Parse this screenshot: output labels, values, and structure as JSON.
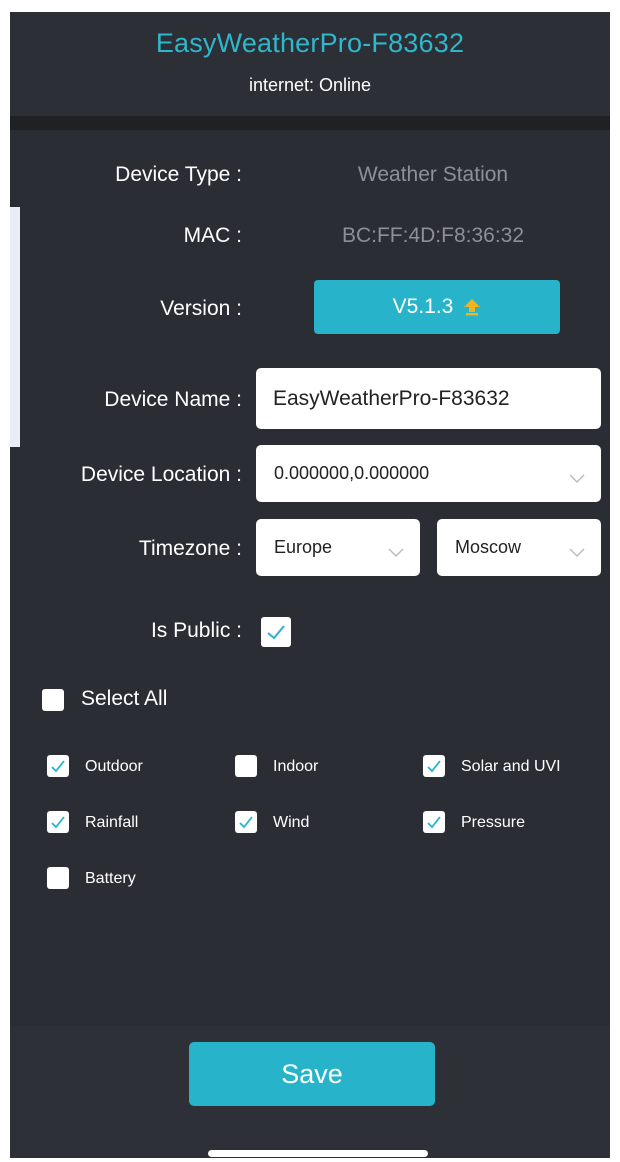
{
  "header": {
    "title": "EasyWeatherPro-F83632",
    "status": "internet: Online"
  },
  "device": {
    "type_label": "Device Type :",
    "type_value": "Weather Station",
    "mac_label": "MAC :",
    "mac_value": "BC:FF:4D:F8:36:32",
    "version_label": "Version :",
    "version_value": "V5.1.3",
    "name_label": "Device Name :",
    "name_value": "EasyWeatherPro-F83632",
    "location_label": "Device Location :",
    "location_value": "0.000000,0.000000",
    "timezone_label": "Timezone :",
    "timezone_region": "Europe",
    "timezone_city": "Moscow",
    "public_label": "Is Public :",
    "public_checked": true
  },
  "options": {
    "select_all_label": "Select All",
    "items": [
      {
        "label": "Outdoor",
        "checked": true
      },
      {
        "label": "Indoor",
        "checked": false
      },
      {
        "label": "Solar and UVI",
        "checked": true
      },
      {
        "label": "Rainfall",
        "checked": true
      },
      {
        "label": "Wind",
        "checked": true
      },
      {
        "label": "Pressure",
        "checked": true
      },
      {
        "label": "Battery",
        "checked": false
      }
    ]
  },
  "footer": {
    "save_label": "Save"
  },
  "colors": {
    "accent": "#27b4cb",
    "title": "#2fb7cc",
    "background": "#2a2d33",
    "upgrade_arrow": "#f2b41c"
  },
  "icons": {
    "upgrade": "upgrade-arrow-icon",
    "dropdown": "chevron-down-icon",
    "check": "checkmark-icon"
  }
}
